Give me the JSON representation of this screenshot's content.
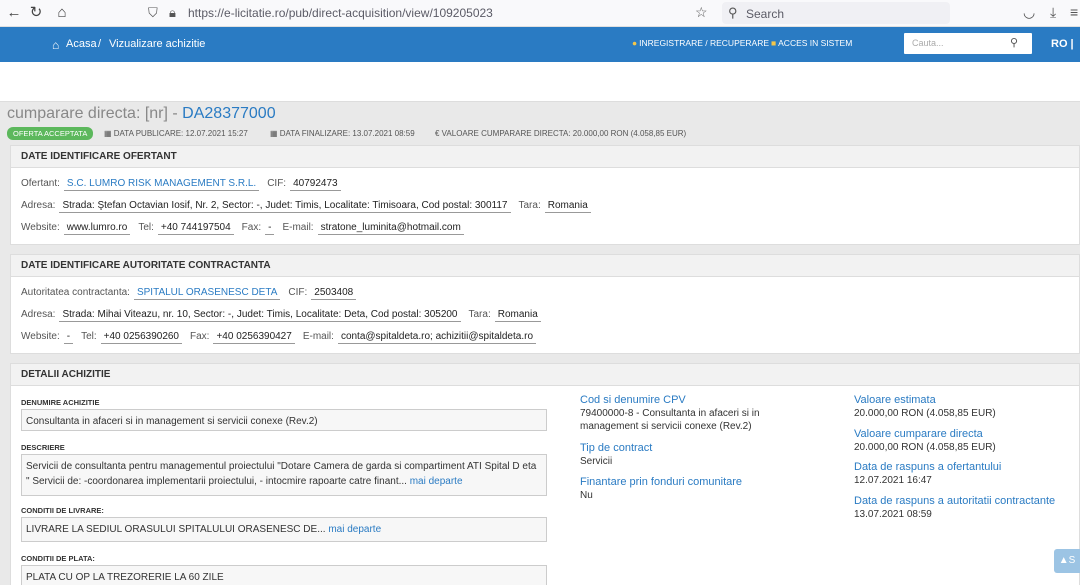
{
  "browser": {
    "url": "https://e-licitatie.ro/pub/direct-acquisition/view/109205023",
    "search_placeholder": "Search"
  },
  "header": {
    "breadcrumb_home": "Acasa",
    "breadcrumb_sep": "/",
    "breadcrumb_current": "Vizualizare achizitie",
    "register_link": "INREGISTRARE / RECUPERARE",
    "login_link": "ACCES IN SISTEM",
    "search_placeholder": "Cauta...",
    "language": "RO |"
  },
  "page": {
    "title_prefix": "cumparare directa: [nr] - ",
    "title_code": "DA28377000",
    "badge": "OFERTA ACCEPTATA",
    "publish_date": "DATA PUBLICARE: 12.07.2021 15:27",
    "finalize_date": "DATA FINALIZARE: 13.07.2021 08:59",
    "value": "€ VALOARE CUMPARARE DIRECTA: 20.000,00  RON (4.058,85  EUR)"
  },
  "ofertant": {
    "heading": "DATE IDENTIFICARE OFERTANT",
    "ofertant_label": "Ofertant:",
    "ofertant_value": "S.C. LUMRO RISK MANAGEMENT S.R.L.",
    "cif_label": "CIF:",
    "cif_value": "40792473",
    "adresa_label": "Adresa:",
    "adresa_value": "Strada: Ştefan Octavian Iosif, Nr. 2, Sector: -, Judet: Timis, Localitate: Timisoara, Cod postal: 300117",
    "tara_label": "Tara:",
    "tara_value": "Romania",
    "website_label": "Website:",
    "website_value": "www.lumro.ro",
    "tel_label": "Tel:",
    "tel_value": "+40 744197504",
    "fax_label": "Fax:",
    "fax_value": "-",
    "email_label": "E-mail:",
    "email_value": "stratone_luminita@hotmail.com"
  },
  "autoritate": {
    "heading": "DATE IDENTIFICARE AUTORITATE CONTRACTANTA",
    "autoritate_label": "Autoritatea contractanta:",
    "autoritate_value": "SPITALUL ORASENESC DETA",
    "cif_label": "CIF:",
    "cif_value": "2503408",
    "adresa_label": "Adresa:",
    "adresa_value": "Strada: Mihai Viteazu, nr. 10, Sector: -, Judet: Timis, Localitate: Deta, Cod postal: 305200",
    "tara_label": "Tara:",
    "tara_value": "Romania",
    "website_label": "Website:",
    "website_value": "-",
    "tel_label": "Tel:",
    "tel_value": "+40 0256390260",
    "fax_label": "Fax:",
    "fax_value": "+40 0256390427",
    "email_label": "E-mail:",
    "email_value": "conta@spitaldeta.ro; achizitii@spitaldeta.ro"
  },
  "detalii": {
    "heading": "DETALII ACHIZITIE",
    "denumire_label": "DENUMIRE ACHIZITIE",
    "denumire_value": "Consultanta in afaceri si in management si servicii conexe (Rev.2)",
    "descriere_label": "DESCRIERE",
    "descriere_value": "Servicii de consultanta pentru managementul proiectului \"Dotare Camera de garda si compartiment ATI Spital D eta \" Servicii de: -coordonarea implementarii proiectului, - intocmire rapoarte catre finant...",
    "more_label": "mai departe",
    "livrare_label": "CONDITII DE LIVRARE:",
    "livrare_value": "LIVRARE LA SEDIUL ORASULUI SPITALULUI ORASENESC DE...",
    "plata_label": "CONDITII DE PLATA:",
    "plata_value": "PLATA CU OP LA TREZORERIE LA 60 ZILE",
    "cpv_title": "Cod si denumire CPV",
    "cpv_value": "79400000-8 - Consultanta in afaceri si in management si servicii conexe (Rev.2)",
    "contract_title": "Tip de contract",
    "contract_value": "Servicii",
    "fonduri_title": "Finantare prin fonduri comunitare",
    "fonduri_value": "Nu",
    "estimata_title": "Valoare estimata",
    "estimata_value": "20.000,00  RON (4.058,85  EUR)",
    "cumparare_title": "Valoare cumparare directa",
    "cumparare_value": "20.000,00  RON (4.058,85  EUR)",
    "raspuns_ofertant_title": "Data de raspuns a ofertantului",
    "raspuns_ofertant_value": "12.07.2021 16:47",
    "raspuns_autoritate_title": "Data de raspuns a autoritatii contractante",
    "raspuns_autoritate_value": "13.07.2021 08:59"
  },
  "scroll_top_label": "S"
}
